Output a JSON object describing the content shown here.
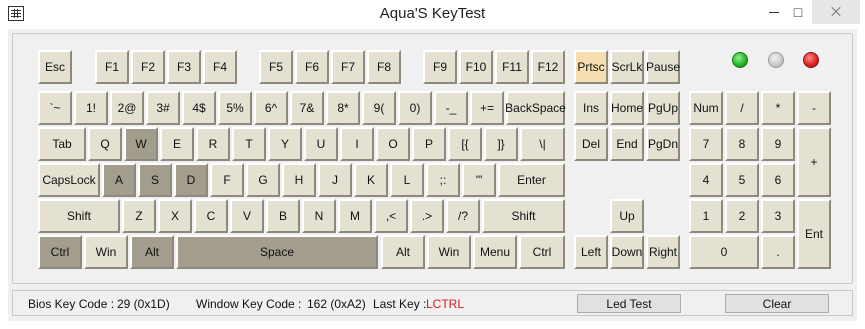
{
  "window": {
    "title": "Aqua'S KeyTest",
    "icon": "keyboard-icon",
    "controls": [
      "minimize",
      "maximize",
      "close"
    ]
  },
  "colors": {
    "key_face": "#e4e1d3",
    "key_pressed": "#a29d8d",
    "key_accent": "#f7deb1",
    "led_green": "#22b322",
    "led_gray": "#c8c8c8",
    "led_red": "#dd1f1f",
    "last_key_text": "#d42020"
  },
  "keys": {
    "esc": "Esc",
    "f1": "F1",
    "f2": "F2",
    "f3": "F3",
    "f4": "F4",
    "f5": "F5",
    "f6": "F6",
    "f7": "F7",
    "f8": "F8",
    "f9": "F9",
    "f10": "F10",
    "f11": "F11",
    "f12": "F12",
    "prtsc": "Prtsc",
    "scrlk": "ScrLk",
    "pause": "Pause",
    "backtick": "`~",
    "1": "1!",
    "2": "2@",
    "3": "3#",
    "4": "4$",
    "5": "5%",
    "6": "6^",
    "7": "7&",
    "8": "8*",
    "9": "9(",
    "0": "0)",
    "minus": "-_",
    "equals": "+=",
    "backspace": "BackSpace",
    "tab": "Tab",
    "q": "Q",
    "w": "W",
    "e": "E",
    "r": "R",
    "t": "T",
    "y": "Y",
    "u": "U",
    "i": "I",
    "o": "O",
    "p": "P",
    "lbracket": "[{",
    "rbracket": "]}",
    "backslash": "\\|",
    "capslock": "CapsLock",
    "a": "A",
    "s": "S",
    "d": "D",
    "f": "F",
    "g": "G",
    "h": "H",
    "j": "J",
    "k": "K",
    "l": "L",
    "semicolon": ";:",
    "quote": "'\"",
    "enter": "Enter",
    "lshift": "Shift",
    "z": "Z",
    "x": "X",
    "c": "C",
    "v": "V",
    "b": "B",
    "n": "N",
    "m": "M",
    "comma": ",<",
    "period": ".>",
    "slash": "/?",
    "rshift": "Shift",
    "lctrl": "Ctrl",
    "lwin": "Win",
    "lalt": "Alt",
    "space": "Space",
    "ralt": "Alt",
    "rwin": "Win",
    "menu": "Menu",
    "rctrl": "Ctrl",
    "ins": "Ins",
    "home": "Home",
    "pgup": "PgUp",
    "del": "Del",
    "end": "End",
    "pgdn": "PgDn",
    "up": "Up",
    "left": "Left",
    "down": "Down",
    "right": "Right",
    "num": "Num",
    "kp_div": "/",
    "kp_mul": "*",
    "kp_minus": "-",
    "kp7": "7",
    "kp8": "8",
    "kp9": "9",
    "kp_plus": "+",
    "kp4": "4",
    "kp5": "5",
    "kp6": "6",
    "kp1": "1",
    "kp2": "2",
    "kp3": "3",
    "kp_enter": "Ent",
    "kp0": "0",
    "kp_dot": "."
  },
  "leds": [
    "green",
    "gray",
    "red"
  ],
  "status": {
    "bios_label": "Bios Key Code :",
    "bios_value": "29 (0x1D)",
    "window_label": "Window Key Code :",
    "window_value": "162 (0xA2)",
    "lastkey_label": "Last Key :",
    "lastkey_value": "LCTRL",
    "led_test_label": "Led Test",
    "clear_label": "Clear"
  }
}
